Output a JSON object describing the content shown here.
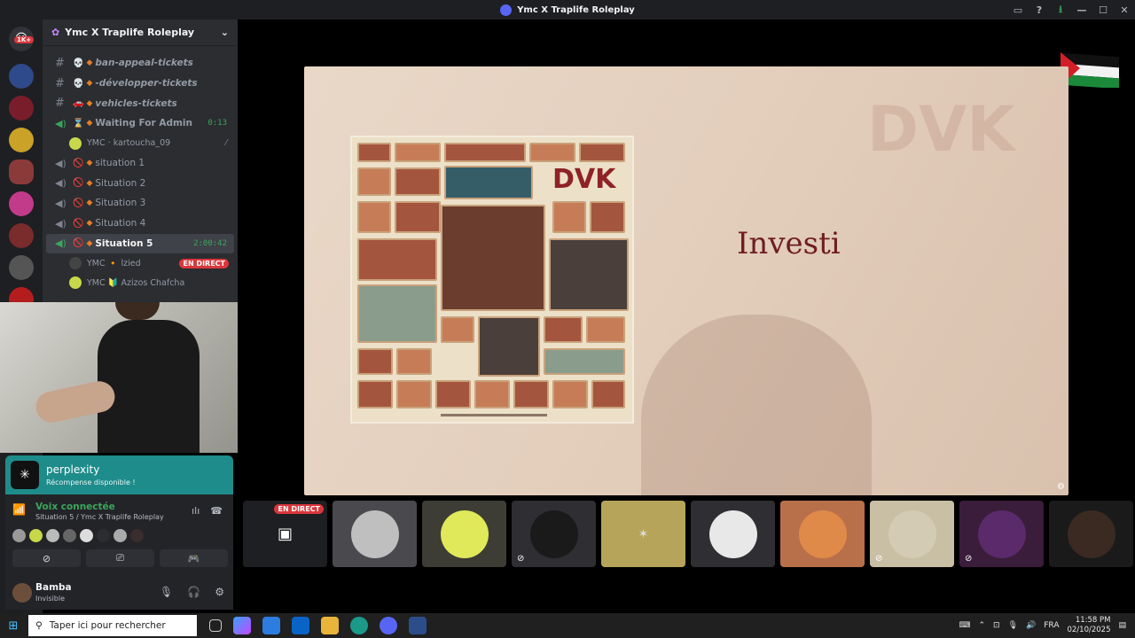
{
  "window": {
    "title": "Ymc X Traplife Roleplay"
  },
  "servers": {
    "badge": "1K+"
  },
  "guild": {
    "name": "Ymc X Traplife Roleplay"
  },
  "channels": [
    {
      "kind": "text",
      "label": "ban-appeal-tickets",
      "italic": true,
      "emoji": "💀"
    },
    {
      "kind": "text",
      "label": "-développer-tickets",
      "italic": true,
      "emoji": "💀"
    },
    {
      "kind": "text",
      "label": "vehicles-tickets",
      "italic": true,
      "emoji": "🚗"
    },
    {
      "kind": "voice",
      "label": "Waiting For Admin",
      "emoji": "⌛",
      "timer": "0:13",
      "bold": true
    },
    {
      "kind": "voice",
      "label": "situation 1",
      "emoji": "🚫"
    },
    {
      "kind": "voice",
      "label": "Situation 2",
      "emoji": "🚫"
    },
    {
      "kind": "voice",
      "label": "Situation 3",
      "emoji": "🚫"
    },
    {
      "kind": "voice",
      "label": "Situation 4",
      "emoji": "🚫"
    },
    {
      "kind": "voice",
      "label": "Situation 5",
      "emoji": "🚫",
      "timer": "2:00:42",
      "active": true
    }
  ],
  "voice_users": {
    "waiting": {
      "name": "YMC · kartoucha_09"
    },
    "s5_user1": {
      "name": "YMC 🔸 lzied",
      "live": "EN DIRECT"
    },
    "s5_user2": {
      "name": "YMC 🔰 Azizos Chafcha"
    }
  },
  "promo": {
    "title": "perplexity",
    "subtitle": "Récompense disponible !"
  },
  "voice": {
    "status": "Voix connectée",
    "channel": "Situation 5 / Ymc X Traplife Roleplay"
  },
  "user": {
    "name": "Bamba",
    "status": "Invisible"
  },
  "stream": {
    "poster_title": "DVK",
    "overlay_text": "Investi",
    "watermark": "DVK"
  },
  "participants": {
    "live_badge": "EN DIRECT"
  },
  "taskbar": {
    "search_placeholder": "Taper ici pour rechercher",
    "lang": "FRA",
    "time": "11:58 PM",
    "date": "02/10/2025"
  },
  "colors": {
    "accent": "#5865f2",
    "voice_green": "#3ba55c",
    "live_red": "#da373c",
    "promo_teal": "#1e8c8a"
  }
}
